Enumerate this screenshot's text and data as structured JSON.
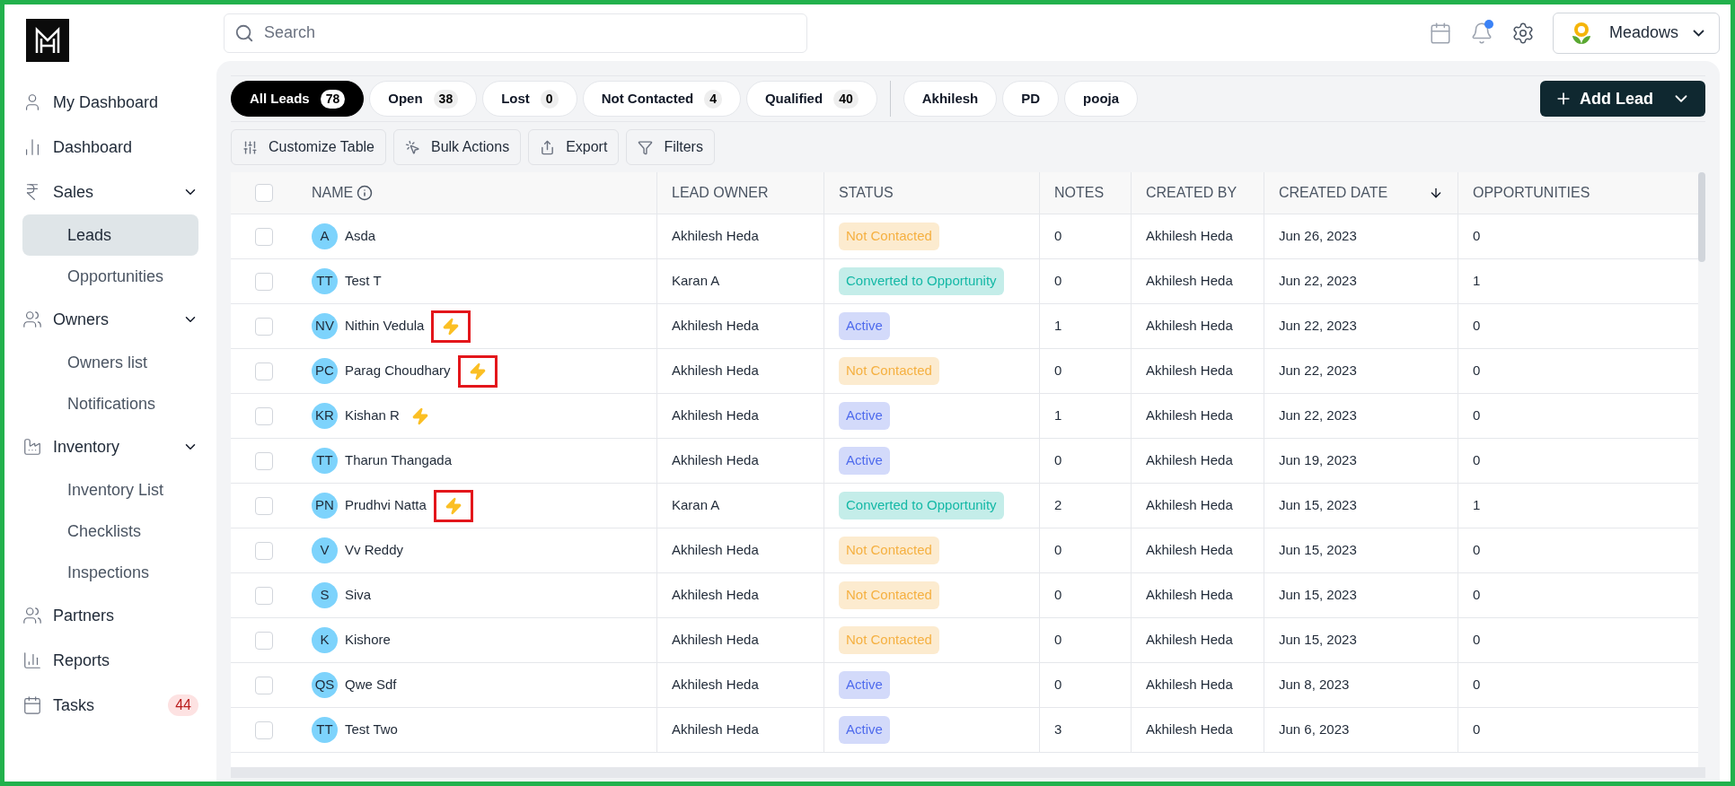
{
  "header": {
    "search": {
      "placeholder": "Search"
    },
    "notification_unread": true,
    "account": "Meadows"
  },
  "sidebar": {
    "items": [
      {
        "label": "My Dashboard",
        "selected": false
      },
      {
        "label": "Dashboard",
        "selected": false
      },
      {
        "label": "Sales",
        "selected": false,
        "expanded": true,
        "children": [
          {
            "label": "Leads",
            "selected": true
          },
          {
            "label": "Opportunities",
            "selected": false
          }
        ]
      },
      {
        "label": "Owners",
        "selected": false,
        "expanded": true,
        "children": [
          {
            "label": "Owners list",
            "selected": false
          },
          {
            "label": "Notifications",
            "selected": false
          }
        ]
      },
      {
        "label": "Inventory",
        "selected": false,
        "expanded": true,
        "children": [
          {
            "label": "Inventory List",
            "selected": false
          },
          {
            "label": "Checklists",
            "selected": false
          },
          {
            "label": "Inspections",
            "selected": false
          }
        ]
      },
      {
        "label": "Partners",
        "selected": false
      },
      {
        "label": "Reports",
        "selected": false
      },
      {
        "label": "Tasks",
        "selected": false,
        "badge": "44"
      }
    ]
  },
  "filters": [
    {
      "label": "All Leads",
      "count": "78",
      "selected": true
    },
    {
      "label": "Open",
      "count": "38",
      "selected": false
    },
    {
      "label": "Lost",
      "count": "0",
      "selected": false
    },
    {
      "label": "Not Contacted",
      "count": "4",
      "selected": false
    },
    {
      "label": "Qualified",
      "count": "40",
      "selected": false
    }
  ],
  "owner_filters": [
    {
      "label": "Akhilesh",
      "selected": false
    },
    {
      "label": "PD",
      "selected": false
    },
    {
      "label": "pooja",
      "selected": false
    }
  ],
  "add_button": "Add Lead",
  "toolbar": [
    "Customize Table",
    "Bulk Actions",
    "Export",
    "Filters"
  ],
  "table": {
    "select_all": {
      "checked": false
    },
    "columns": [
      "NAME",
      "LEAD OWNER",
      "STATUS",
      "NOTES",
      "CREATED BY",
      "CREATED DATE",
      "OPPORTUNITIES"
    ],
    "rows": [
      {
        "initials": "A",
        "name": "Asda",
        "bolt": false,
        "highlighted": false,
        "checked": false,
        "owner": "Akhilesh Heda",
        "status": "Not Contacted",
        "color": "#f5b041",
        "notes": "0",
        "created_by": "Akhilesh Heda",
        "created_date": "Jun 26, 2023",
        "opportunities": "0"
      },
      {
        "initials": "TT",
        "name": "Test T",
        "bolt": false,
        "highlighted": false,
        "checked": false,
        "owner": "Karan A",
        "status": "Converted to Opportunity",
        "color": "#14b8a6",
        "notes": "0",
        "created_by": "Akhilesh Heda",
        "created_date": "Jun 22, 2023",
        "opportunities": "1"
      },
      {
        "initials": "NV",
        "name": "Nithin Vedula",
        "bolt": true,
        "highlighted": true,
        "checked": false,
        "owner": "Akhilesh Heda",
        "status": "Active",
        "color": "#4f6bed",
        "notes": "1",
        "created_by": "Akhilesh Heda",
        "created_date": "Jun 22, 2023",
        "opportunities": "0"
      },
      {
        "initials": "PC",
        "name": "Parag Choudhary",
        "bolt": true,
        "highlighted": true,
        "checked": false,
        "owner": "Akhilesh Heda",
        "status": "Not Contacted",
        "color": "#f5b041",
        "notes": "0",
        "created_by": "Akhilesh Heda",
        "created_date": "Jun 22, 2023",
        "opportunities": "0"
      },
      {
        "initials": "KR",
        "name": "Kishan R",
        "bolt": true,
        "highlighted": false,
        "checked": false,
        "owner": "Akhilesh Heda",
        "status": "Active",
        "color": "#4f6bed",
        "notes": "1",
        "created_by": "Akhilesh Heda",
        "created_date": "Jun 22, 2023",
        "opportunities": "0"
      },
      {
        "initials": "TT",
        "name": "Tharun Thangada",
        "bolt": false,
        "highlighted": false,
        "checked": false,
        "owner": "Akhilesh Heda",
        "status": "Active",
        "color": "#4f6bed",
        "notes": "0",
        "created_by": "Akhilesh Heda",
        "created_date": "Jun 19, 2023",
        "opportunities": "0"
      },
      {
        "initials": "PN",
        "name": "Prudhvi Natta",
        "bolt": true,
        "highlighted": true,
        "checked": false,
        "owner": "Karan A",
        "status": "Converted to Opportunity",
        "color": "#14b8a6",
        "notes": "2",
        "created_by": "Akhilesh Heda",
        "created_date": "Jun 15, 2023",
        "opportunities": "1"
      },
      {
        "initials": "V",
        "name": "Vv Reddy",
        "bolt": false,
        "highlighted": false,
        "checked": false,
        "owner": "Akhilesh Heda",
        "status": "Not Contacted",
        "color": "#f5b041",
        "notes": "0",
        "created_by": "Akhilesh Heda",
        "created_date": "Jun 15, 2023",
        "opportunities": "0"
      },
      {
        "initials": "S",
        "name": "Siva",
        "bolt": false,
        "highlighted": false,
        "checked": false,
        "owner": "Akhilesh Heda",
        "status": "Not Contacted",
        "color": "#f5b041",
        "notes": "0",
        "created_by": "Akhilesh Heda",
        "created_date": "Jun 15, 2023",
        "opportunities": "0"
      },
      {
        "initials": "K",
        "name": "Kishore",
        "bolt": false,
        "highlighted": false,
        "checked": false,
        "owner": "Akhilesh Heda",
        "status": "Not Contacted",
        "color": "#f5b041",
        "notes": "0",
        "created_by": "Akhilesh Heda",
        "created_date": "Jun 15, 2023",
        "opportunities": "0"
      },
      {
        "initials": "QS",
        "name": "Qwe Sdf",
        "bolt": false,
        "highlighted": false,
        "checked": false,
        "owner": "Akhilesh Heda",
        "status": "Active",
        "color": "#4f6bed",
        "notes": "0",
        "created_by": "Akhilesh Heda",
        "created_date": "Jun 8, 2023",
        "opportunities": "0"
      },
      {
        "initials": "TT",
        "name": "Test Two",
        "bolt": false,
        "highlighted": false,
        "checked": false,
        "owner": "Akhilesh Heda",
        "status": "Active",
        "color": "#4f6bed",
        "notes": "3",
        "created_by": "Akhilesh Heda",
        "created_date": "Jun 6, 2023",
        "opportunities": "0"
      }
    ]
  }
}
